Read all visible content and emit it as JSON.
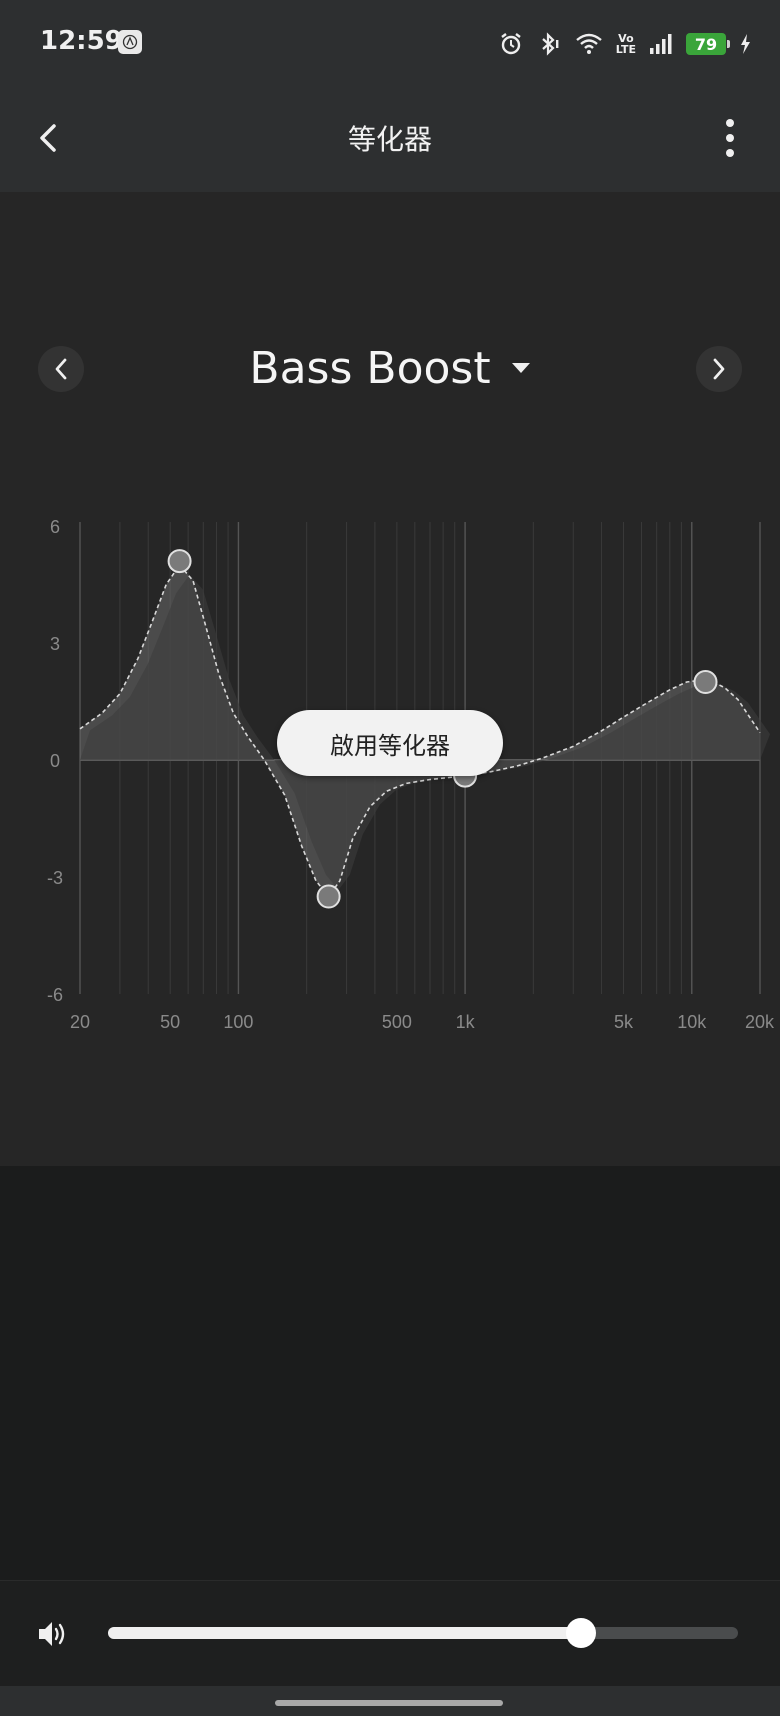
{
  "status_bar": {
    "time": "12:59",
    "app_icon": "audio-technica-logo-icon",
    "icons": [
      "alarm-icon",
      "bluetooth-icon",
      "wifi-icon",
      "volte-icon",
      "signal-icon",
      "battery-icon",
      "charging-icon"
    ],
    "volte_top": "Vo",
    "volte_bottom": "LTE",
    "battery_level": "79",
    "battery_color": "#3aa53a"
  },
  "app_bar": {
    "title": "等化器",
    "back_icon": "chevron-left-icon",
    "menu_icon": "more-vertical-icon"
  },
  "preset": {
    "name": "Bass Boost",
    "dropdown_icon": "caret-down-icon",
    "prev_icon": "chevron-left-icon",
    "next_icon": "chevron-right-icon"
  },
  "chart_data": {
    "type": "line",
    "x_scale": "log",
    "xlim": [
      20,
      20000
    ],
    "ylim": [
      -6,
      6
    ],
    "y_ticks": [
      6,
      3,
      0,
      -3,
      -6
    ],
    "y_tick_labels": [
      "6",
      "3",
      "0",
      "-3",
      "-6"
    ],
    "x_ticks": [
      20,
      50,
      100,
      500,
      1000,
      5000,
      10000,
      20000
    ],
    "x_tick_labels": [
      "20",
      "50",
      "100",
      "500",
      "1k",
      "5k",
      "10k",
      "20k"
    ],
    "grid": true,
    "control_points": [
      {
        "x": 55,
        "y": 5.1
      },
      {
        "x": 250,
        "y": -3.5
      },
      {
        "x": 1000,
        "y": -0.4
      },
      {
        "x": 11500,
        "y": 2.0
      }
    ],
    "curve": {
      "x": [
        20,
        25,
        30,
        36,
        42,
        48,
        55,
        63,
        72,
        82,
        95,
        110,
        130,
        160,
        190,
        220,
        250,
        280,
        320,
        380,
        450,
        550,
        700,
        850,
        1000,
        1300,
        1700,
        2200,
        3000,
        4000,
        5000,
        6500,
        8000,
        9500,
        11000,
        12500,
        14000,
        16000,
        18000,
        20000
      ],
      "y": [
        0.8,
        1.2,
        1.7,
        2.6,
        3.6,
        4.5,
        5.0,
        4.6,
        3.4,
        2.2,
        1.2,
        0.6,
        0.0,
        -0.9,
        -2.2,
        -3.1,
        -3.5,
        -3.1,
        -2.0,
        -1.2,
        -0.8,
        -0.6,
        -0.5,
        -0.45,
        -0.4,
        -0.3,
        -0.15,
        0.05,
        0.35,
        0.75,
        1.1,
        1.5,
        1.8,
        2.0,
        2.05,
        2.0,
        1.85,
        1.55,
        1.1,
        0.7
      ]
    }
  },
  "enable_button": {
    "label": "啟用等化器"
  },
  "volume": {
    "icon": "speaker-volume-icon",
    "level": 0.75
  }
}
